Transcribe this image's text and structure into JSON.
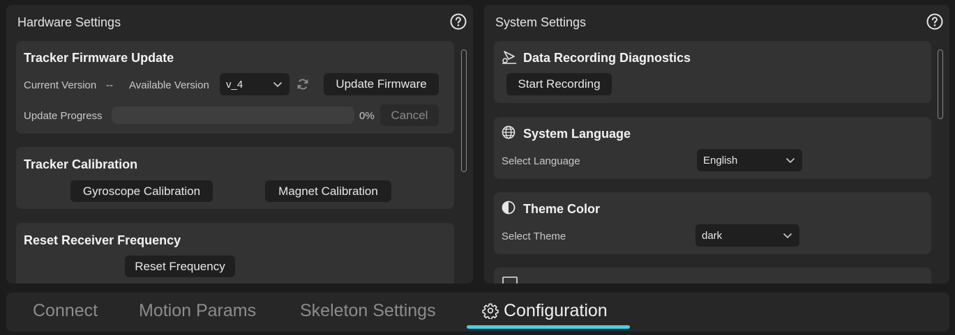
{
  "hardware": {
    "title": "Hardware Settings",
    "firmware": {
      "title": "Tracker Firmware Update",
      "current_version_label": "Current Version",
      "current_version_value": "--",
      "available_version_label": "Available Version",
      "available_version_value": "v_4",
      "update_button": "Update Firmware",
      "progress_label": "Update Progress",
      "progress_percent": 0,
      "progress_text": "0%",
      "cancel_button": "Cancel"
    },
    "calibration": {
      "title": "Tracker Calibration",
      "gyro_button": "Gyroscope Calibration",
      "magnet_button": "Magnet Calibration"
    },
    "reset": {
      "title": "Reset Receiver Frequency",
      "button": "Reset Frequency"
    }
  },
  "system": {
    "title": "System Settings",
    "diagnostics": {
      "title": "Data Recording Diagnostics",
      "button": "Start Recording"
    },
    "language": {
      "title": "System Language",
      "label": "Select Language",
      "value": "English"
    },
    "theme": {
      "title": "Theme Color",
      "label": "Select Theme",
      "value": "dark"
    }
  },
  "tabs": [
    {
      "label": "Connect",
      "active": false
    },
    {
      "label": "Motion Params",
      "active": false
    },
    {
      "label": "Skeleton Settings",
      "active": false
    },
    {
      "label": "Configuration",
      "active": true
    }
  ],
  "colors": {
    "accent": "#3fd3e8",
    "background": "#1c1c1c",
    "panel": "#272727",
    "card": "#333333"
  }
}
